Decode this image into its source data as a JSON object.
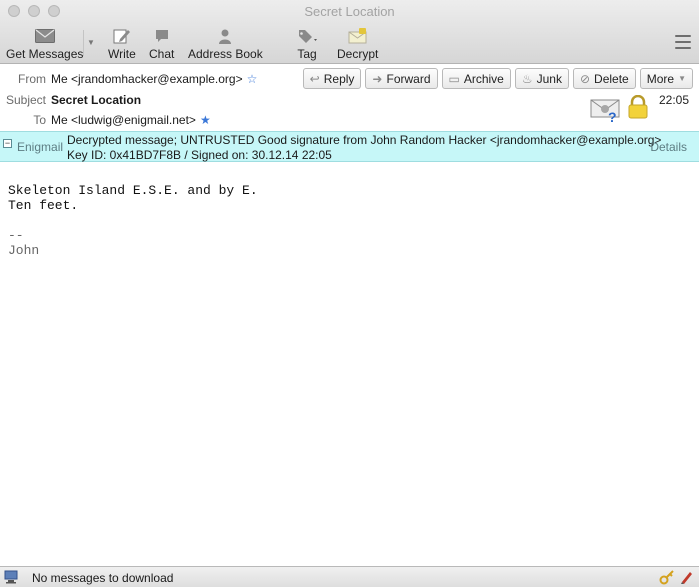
{
  "window": {
    "title": "Secret Location"
  },
  "toolbar": {
    "get_messages": "Get Messages",
    "write": "Write",
    "chat": "Chat",
    "address_book": "Address Book",
    "tag": "Tag",
    "decrypt": "Decrypt"
  },
  "header": {
    "from_label": "From",
    "from_value": "Me <jrandomhacker@example.org>",
    "subject_label": "Subject",
    "subject_value": "Secret Location",
    "to_label": "To",
    "to_value": "Me <ludwig@enigmail.net>",
    "time": "22:05",
    "actions": {
      "reply": "Reply",
      "forward": "Forward",
      "archive": "Archive",
      "junk": "Junk",
      "delete": "Delete",
      "more": "More"
    }
  },
  "enigmail": {
    "label": "Enigmail",
    "line1": "Decrypted message; UNTRUSTED Good signature from John Random Hacker <jrandomhacker@example.org>",
    "line2": "Key ID: 0x41BD7F8B / Signed on: 30.12.14 22:05",
    "details": "Details",
    "bg_color": "#c6f7f8"
  },
  "message": {
    "lines": [
      "Skeleton Island E.S.E. and by E.",
      "Ten feet."
    ],
    "sig_sep": "--",
    "signature": "John"
  },
  "status": {
    "text": "No messages to download"
  }
}
